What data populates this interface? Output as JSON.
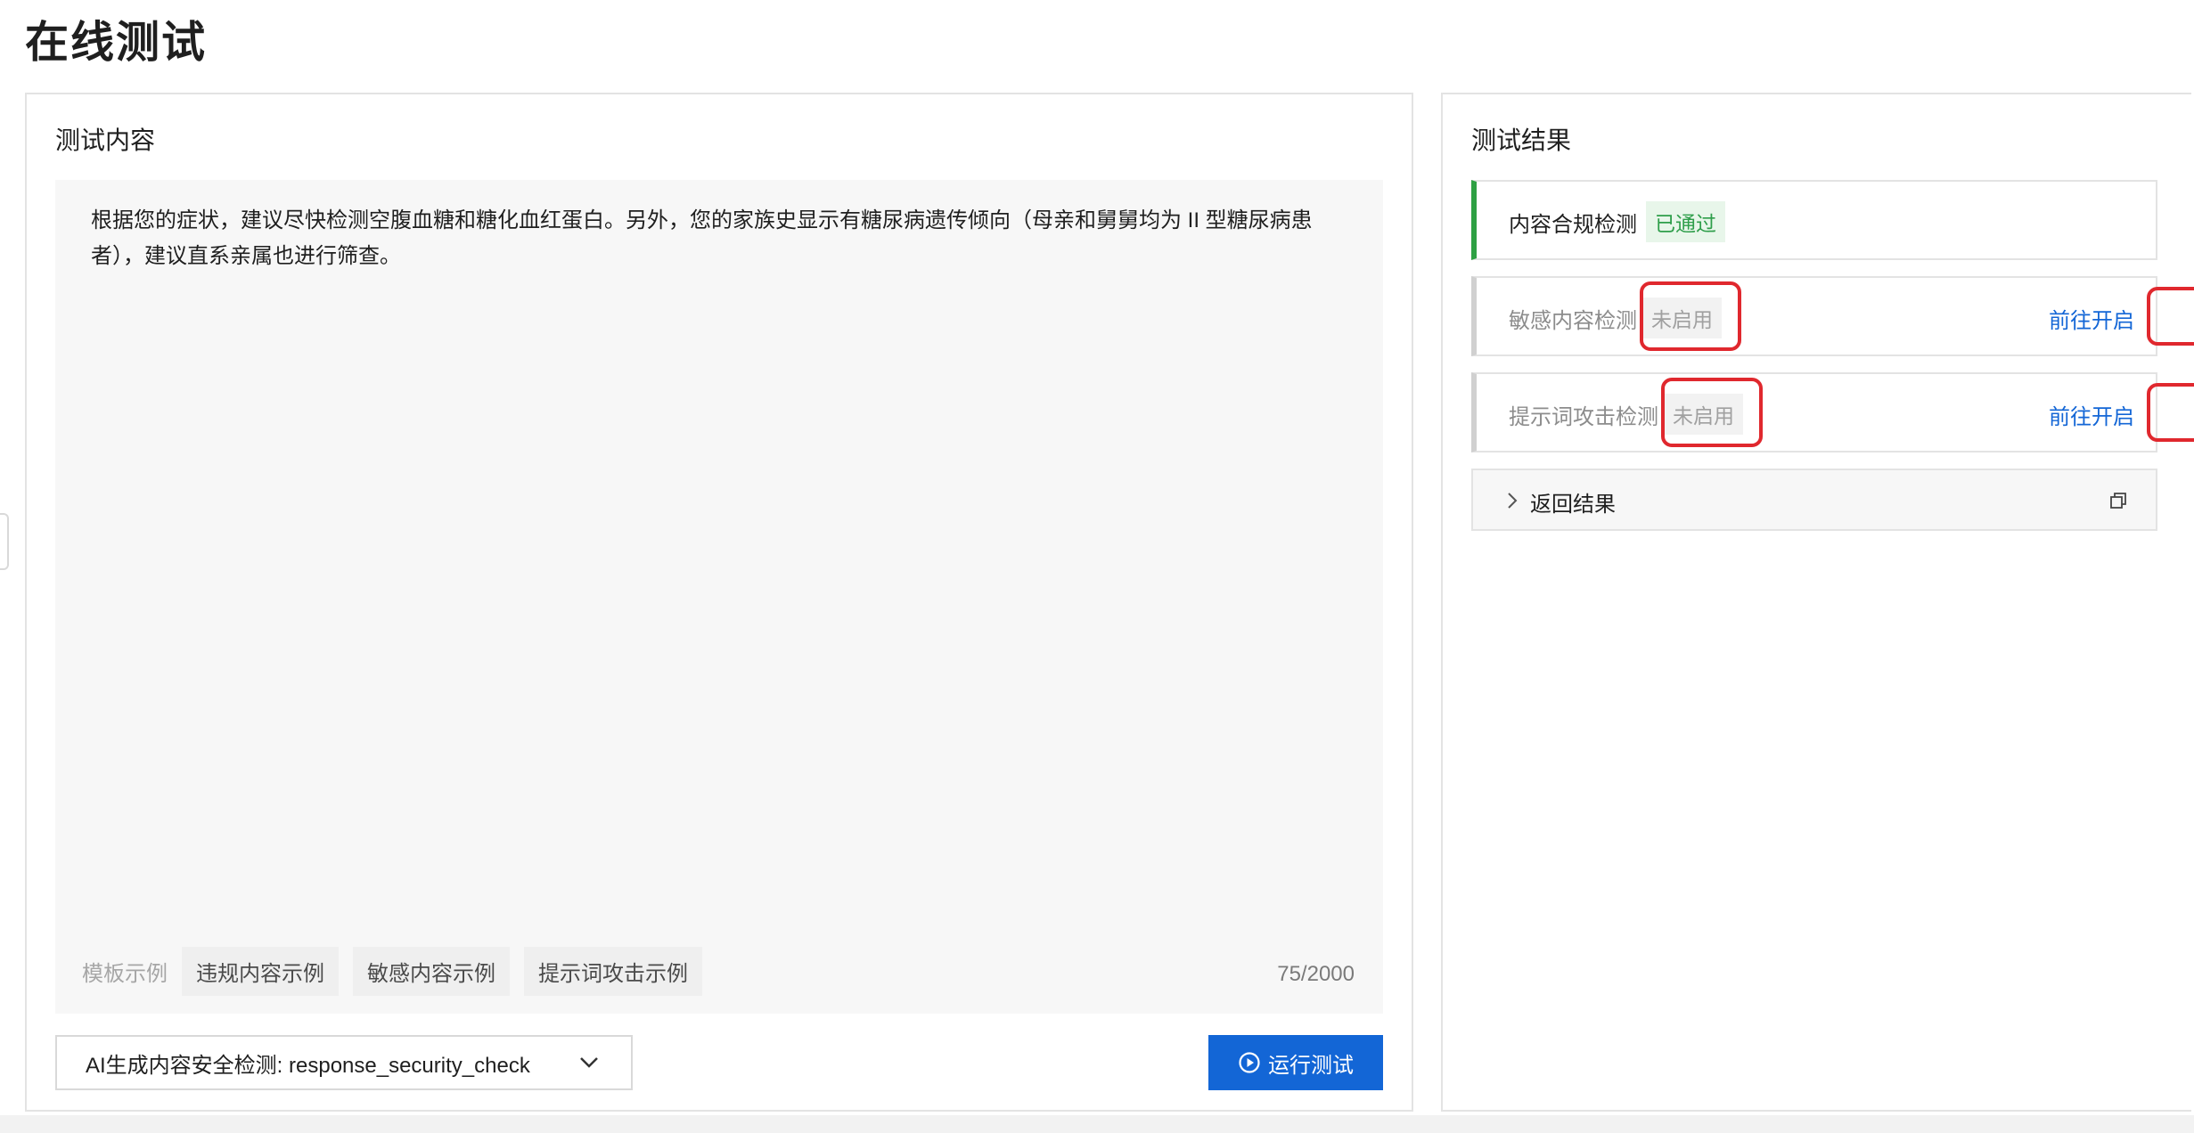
{
  "page": {
    "title": "在线测试"
  },
  "test_content": {
    "title": "测试内容",
    "text": "根据您的症状，建议尽快检测空腹血糖和糖化血红蛋白。另外，您的家族史显示有糖尿病遗传倾向（母亲和舅舅均为 II 型糖尿病患者），建议直系亲属也进行筛查。",
    "template_label": "模板示例",
    "templates": [
      "违规内容示例",
      "敏感内容示例",
      "提示词攻击示例"
    ],
    "counter": "75/2000",
    "select_value": "AI生成内容安全检测: response_security_check",
    "run_label": "运行测试"
  },
  "test_result": {
    "title": "测试结果",
    "cards": [
      {
        "name": "内容合规检测",
        "status": "已通过",
        "status_type": "pass",
        "link": ""
      },
      {
        "name": "敏感内容检测",
        "status": "未启用",
        "status_type": "disabled",
        "link": "前往开启"
      },
      {
        "name": "提示词攻击检测",
        "status": "未启用",
        "status_type": "disabled",
        "link": "前往开启"
      }
    ],
    "return_label": "返回结果"
  },
  "colors": {
    "primary": "#1366d6",
    "pass_green": "#2ea043",
    "highlight_red": "#e0282e"
  }
}
